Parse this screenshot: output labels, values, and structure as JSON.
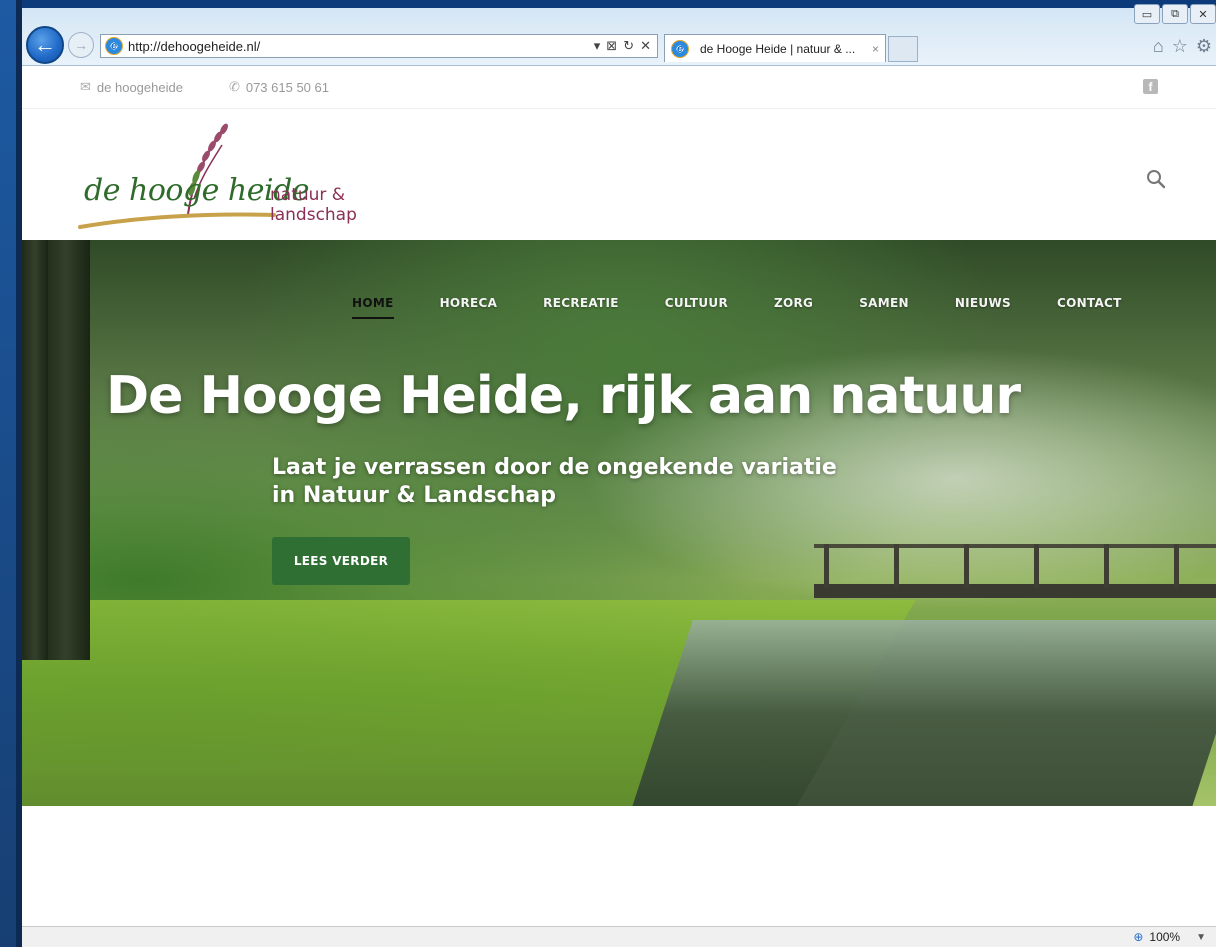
{
  "browser": {
    "url": "http://dehoogeheide.nl/",
    "tab_title": "de Hooge Heide | natuur & ...",
    "tab_close": "×",
    "zoom": "100%",
    "controls": {
      "minimize": "▭",
      "restore": "⧉",
      "close": "✕"
    },
    "addr_tools": {
      "dropdown": "▾",
      "compat": "⊠",
      "refresh": "↻",
      "stop": "✕"
    },
    "right_tools": {
      "home": "⌂",
      "favorites": "☆",
      "settings": "⚙"
    },
    "back_glyph": "←",
    "forward_glyph": "→"
  },
  "topbar": {
    "email_label": "de hoogeheide",
    "phone_label": "073 615 50 61",
    "mail_glyph": "✉",
    "phone_glyph": "✆",
    "facebook_glyph": "f"
  },
  "logo": {
    "script": "de hooge heide",
    "tagline": "natuur & landschap"
  },
  "nav": {
    "items": [
      {
        "label": "HOME"
      },
      {
        "label": "HORECA"
      },
      {
        "label": "RECREATIE"
      },
      {
        "label": "CULTUUR"
      },
      {
        "label": "ZORG"
      },
      {
        "label": "SAMEN"
      },
      {
        "label": "NIEUWS"
      },
      {
        "label": "CONTACT"
      }
    ],
    "active_index": 0
  },
  "hero": {
    "title": "De Hooge Heide, rijk aan natuur",
    "subtitle_line1": "Laat je verrassen door de ongekende variatie",
    "subtitle_line2": "in Natuur & Landschap",
    "button_label": "LEES VERDER"
  },
  "colors": {
    "brand_green": "#2f6f33",
    "logo_green": "#2f6b2a",
    "logo_tagline": "#8a2f55",
    "ie_blue": "#1f68c6"
  }
}
